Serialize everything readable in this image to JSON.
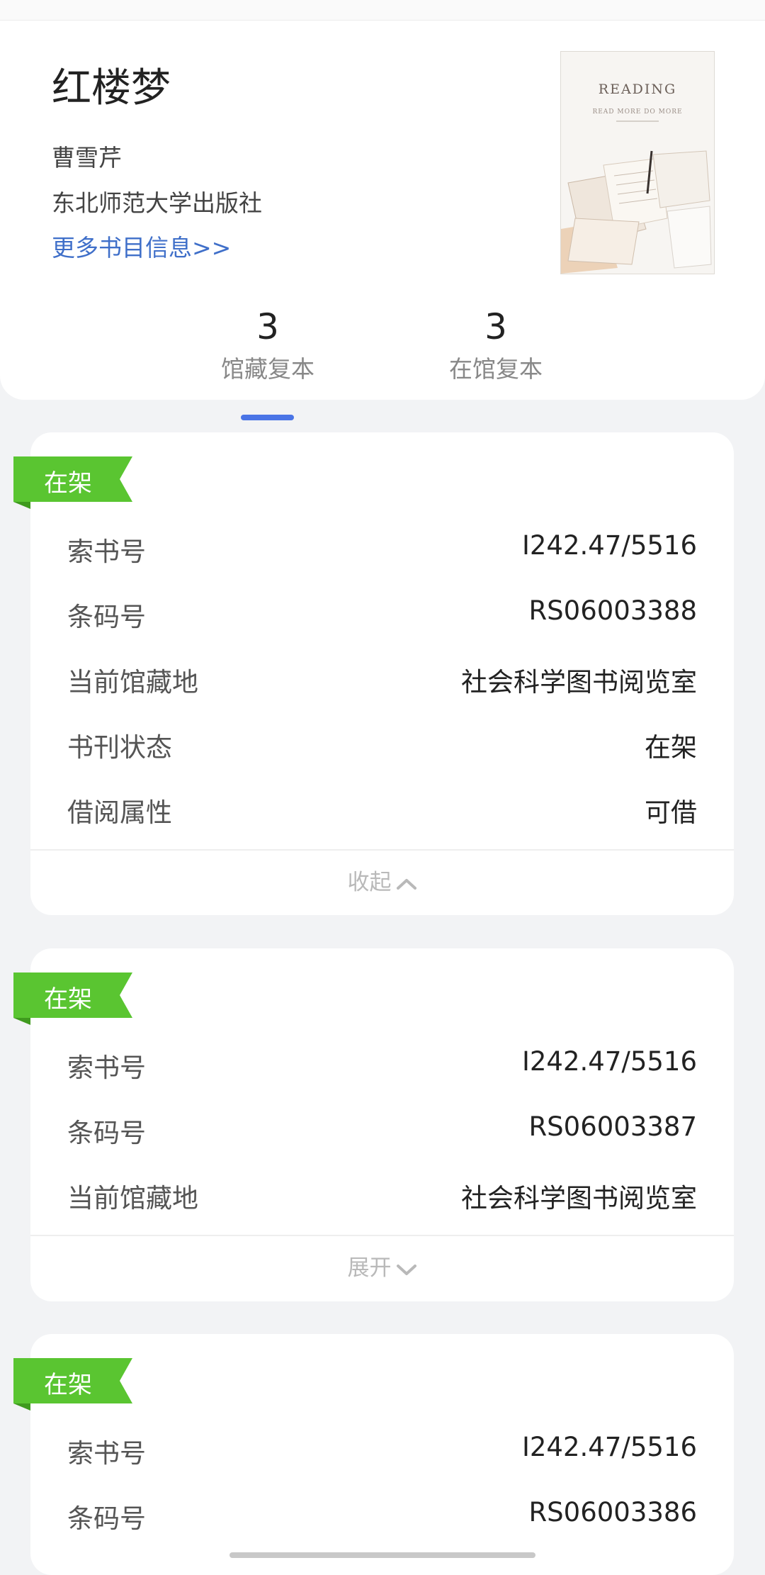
{
  "book": {
    "title": "红楼梦",
    "author": "曹雪芹",
    "publisher": "东北师范大学出版社",
    "more_link": "更多书目信息>>",
    "cover": {
      "title": "READING",
      "subtitle": "READ MORE  DO MORE"
    }
  },
  "stats": [
    {
      "value": "3",
      "label": "馆藏复本"
    },
    {
      "value": "3",
      "label": "在馆复本"
    }
  ],
  "copies": [
    {
      "status": "在架",
      "fields": [
        {
          "k": "索书号",
          "v": "I242.47/5516"
        },
        {
          "k": "条码号",
          "v": "RS06003388"
        },
        {
          "k": "当前馆藏地",
          "v": "社会科学图书阅览室"
        },
        {
          "k": "书刊状态",
          "v": "在架"
        },
        {
          "k": "借阅属性",
          "v": "可借"
        }
      ],
      "toggle": "收起"
    },
    {
      "status": "在架",
      "fields": [
        {
          "k": "索书号",
          "v": "I242.47/5516"
        },
        {
          "k": "条码号",
          "v": "RS06003387"
        },
        {
          "k": "当前馆藏地",
          "v": "社会科学图书阅览室"
        }
      ],
      "toggle": "展开"
    },
    {
      "status": "在架",
      "fields": [
        {
          "k": "索书号",
          "v": "I242.47/5516"
        },
        {
          "k": "条码号",
          "v": "RS06003386"
        }
      ]
    }
  ],
  "colors": {
    "accent": "#4a74e6",
    "link": "#3f6fc9",
    "ribbon": "#5ac531",
    "ribbon_dark": "#3f9a1e"
  }
}
